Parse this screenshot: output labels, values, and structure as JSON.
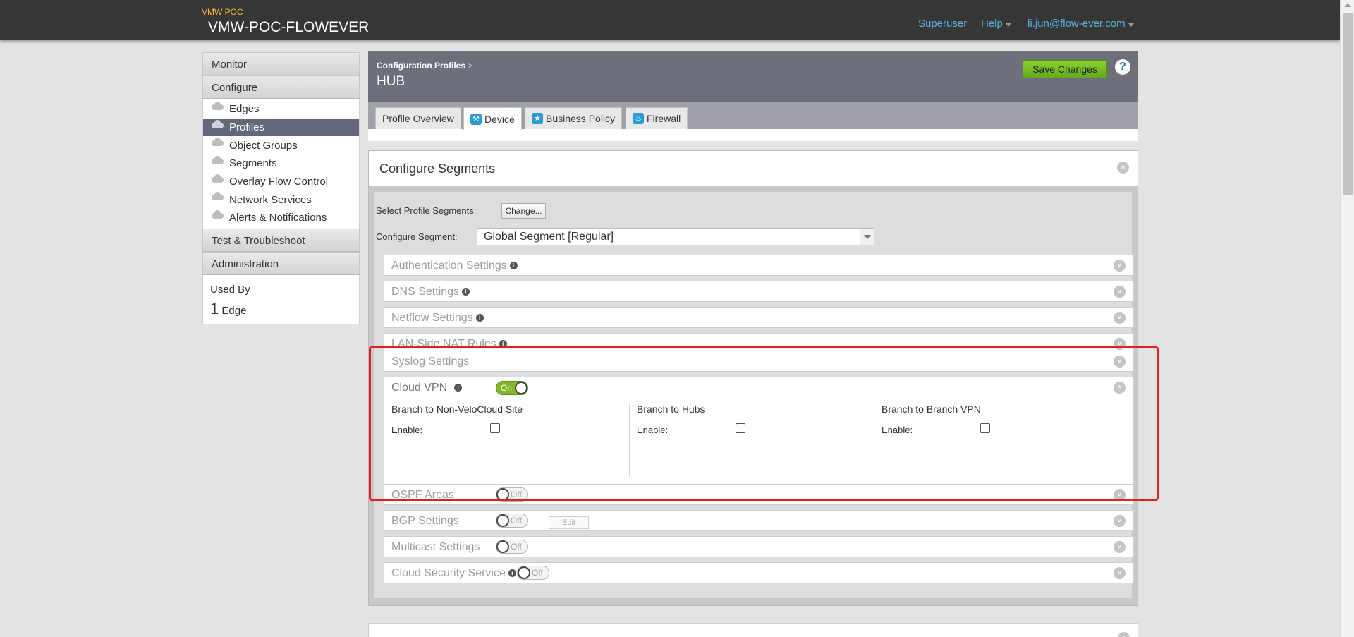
{
  "app": {
    "org_label": "VMW POC",
    "org_title": "VMW-POC-FLOWEVER"
  },
  "topnav": {
    "superuser": "Superuser",
    "help": "Help",
    "user": "li.jun@flow-ever.com"
  },
  "sidebar": {
    "monitor": "Monitor",
    "configure": "Configure",
    "items": [
      {
        "label": "Edges"
      },
      {
        "label": "Profiles"
      },
      {
        "label": "Object Groups"
      },
      {
        "label": "Segments"
      },
      {
        "label": "Overlay Flow Control"
      },
      {
        "label": "Network Services"
      },
      {
        "label": "Alerts & Notifications"
      }
    ],
    "test": "Test & Troubleshoot",
    "admin": "Administration",
    "used_by_label": "Used By",
    "used_by_count": "1",
    "used_by_unit": "Edge"
  },
  "header": {
    "breadcrumb": "Configuration Profiles",
    "breadcrumb_sep": ">",
    "title": "HUB",
    "save": "Save Changes",
    "help": "?"
  },
  "tabs": [
    {
      "label": "Profile Overview"
    },
    {
      "label": "Device"
    },
    {
      "label": "Business Policy"
    },
    {
      "label": "Firewall"
    }
  ],
  "segments": {
    "title": "Configure Segments",
    "select_label": "Select Profile Segments:",
    "change": "Change...",
    "configure_label": "Configure Segment:",
    "configure_value": "Global Segment [Regular]",
    "panels": [
      {
        "title": "Authentication Settings"
      },
      {
        "title": "DNS Settings"
      },
      {
        "title": "Netflow Settings"
      },
      {
        "title": "LAN-Side NAT Rules"
      },
      {
        "title": "Syslog Settings"
      }
    ],
    "cloud_vpn": {
      "title": "Cloud VPN",
      "toggle": "On",
      "columns": [
        {
          "title": "Branch to Non-VeloCloud Site",
          "enable": "Enable:"
        },
        {
          "title": "Branch to Hubs",
          "enable": "Enable:"
        },
        {
          "title": "Branch to Branch VPN",
          "enable": "Enable:"
        }
      ]
    },
    "lower_panels": [
      {
        "title": "OSPF Areas",
        "toggle": "Off"
      },
      {
        "title": "BGP Settings",
        "toggle": "Off",
        "edit": "Edit"
      },
      {
        "title": "Multicast Settings",
        "toggle": "Off"
      },
      {
        "title": "Cloud Security Service",
        "toggle": "Off"
      }
    ]
  },
  "colors": {
    "topbar": "#363636",
    "accent_link": "#5ab1de",
    "save_green": "#7fba25",
    "header_band": "#6d6f7b",
    "highlight_box": "#e4211a"
  }
}
